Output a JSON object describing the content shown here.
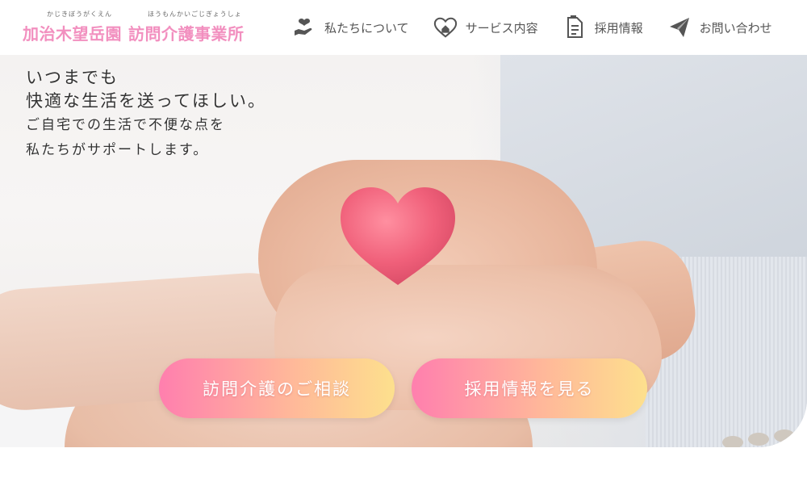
{
  "header": {
    "ruby_left": "かじきぼうがくえん",
    "ruby_right": "ほうもんかいごじぎょうしょ",
    "org_name_part1": "加治木望岳園",
    "org_name_part2": "訪問介護事業所"
  },
  "nav": {
    "items": [
      {
        "label": "私たちについて",
        "icon": "heart-hand-icon"
      },
      {
        "label": "サービス内容",
        "icon": "heart-house-icon"
      },
      {
        "label": "採用情報",
        "icon": "document-icon"
      },
      {
        "label": "お問い合わせ",
        "icon": "paper-plane-icon"
      }
    ]
  },
  "hero": {
    "line1": "いつまでも",
    "line2": "快適な生活を送ってほしい。",
    "line3": "ご自宅での生活で不便な点を",
    "line4": "私たちがサポートします。"
  },
  "cta": {
    "consult_label": "訪問介護のご相談",
    "recruit_label": "採用情報を見る"
  },
  "colors": {
    "brand_pink": "#f28fbf",
    "cta_gradient_start": "#ff7fae",
    "cta_gradient_end": "#fde08d",
    "heart": "#f0607a"
  }
}
